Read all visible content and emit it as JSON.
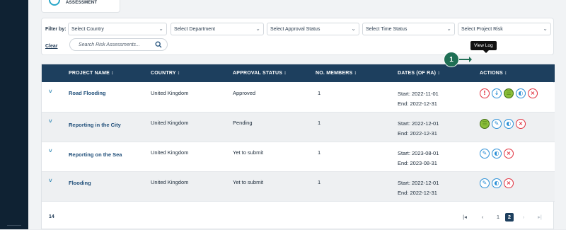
{
  "top_card": {
    "label": "ASSESSMENT"
  },
  "filters": {
    "filter_by": "Filter by:",
    "clear": "Clear",
    "selects": [
      "Select Country",
      "Select Department",
      "Select Approval Status",
      "Select Time Status",
      "Select Project Risk"
    ],
    "search_placeholder": "Search Risk Assessments..."
  },
  "table": {
    "headers": [
      "PROJECT NAME ↕",
      "COUNTRY ↕",
      "APPROVAL STATUS ↕",
      "NO. MEMBERS ↕",
      "DATES (OF RA) ↕",
      "ACTIONS ↕"
    ],
    "rows": [
      {
        "name": "Road Flooding",
        "country": "United Kingdom",
        "status": "Approved",
        "members": "1",
        "start": "Start: 2022-11-01",
        "end": "End: 2022-12-31"
      },
      {
        "name": "Reporting in the City",
        "country": "United Kingdom",
        "status": "Pending",
        "members": "1",
        "start": "Start: 2022-12-01",
        "end": "End: 2022-12-31"
      },
      {
        "name": "Reporting on the Sea",
        "country": "United Kingdom",
        "status": "Yet to submit",
        "members": "1",
        "start": "Start: 2023-08-01",
        "end": "End: 2023-08-31"
      },
      {
        "name": "Flooding",
        "country": "United Kingdom",
        "status": "Yet to submit",
        "members": "1",
        "start": "Start: 2022-12-01",
        "end": "End: 2022-12-31"
      }
    ],
    "expand_glyph": "˅"
  },
  "tooltip": "View Log",
  "marker": "1",
  "footer": {
    "count": "14",
    "first": "|◂",
    "prev": "‹",
    "pages": [
      "1",
      "2"
    ],
    "next": "›",
    "last": "▸|"
  },
  "icons": {
    "alert": "!",
    "download": "↓",
    "log": "☰",
    "edit": "✎",
    "toggle": "◐",
    "delete": "×"
  },
  "colors": {
    "header": "#1d3f5e",
    "accent": "#2aa7c9",
    "danger": "#e0303e",
    "marker": "#1f6f55"
  }
}
